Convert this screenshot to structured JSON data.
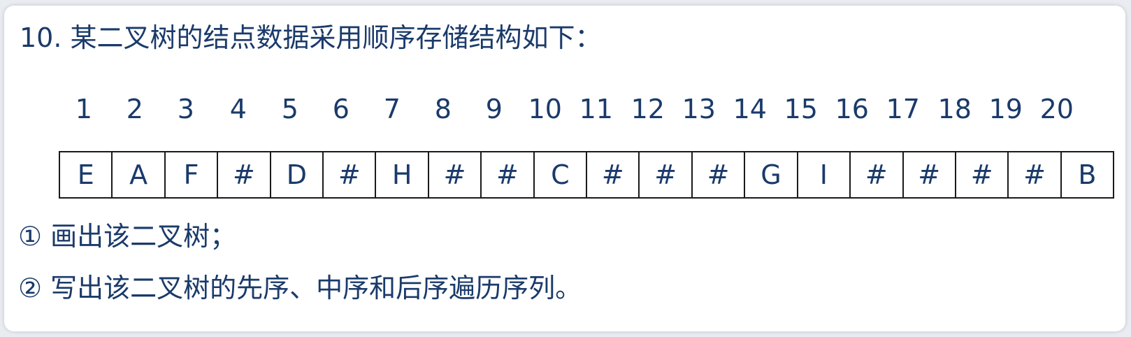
{
  "question": {
    "title": "10. 某二叉树的结点数据采用顺序存储结构如下：",
    "part1": "① 画出该二叉树；",
    "part2": "② 写出该二叉树的先序、中序和后序遍历序列。"
  },
  "table": {
    "indices": [
      "1",
      "2",
      "3",
      "4",
      "5",
      "6",
      "7",
      "8",
      "9",
      "10",
      "11",
      "12",
      "13",
      "14",
      "15",
      "16",
      "17",
      "18",
      "19",
      "20"
    ],
    "values": [
      "E",
      "A",
      "F",
      "#",
      "D",
      "#",
      "H",
      "#",
      "#",
      "C",
      "#",
      "#",
      "#",
      "G",
      "I",
      "#",
      "#",
      "#",
      "#",
      "B"
    ]
  },
  "colors": {
    "text": "#1a3a6a",
    "border": "#1a1a1a",
    "background": "#ffffff"
  }
}
